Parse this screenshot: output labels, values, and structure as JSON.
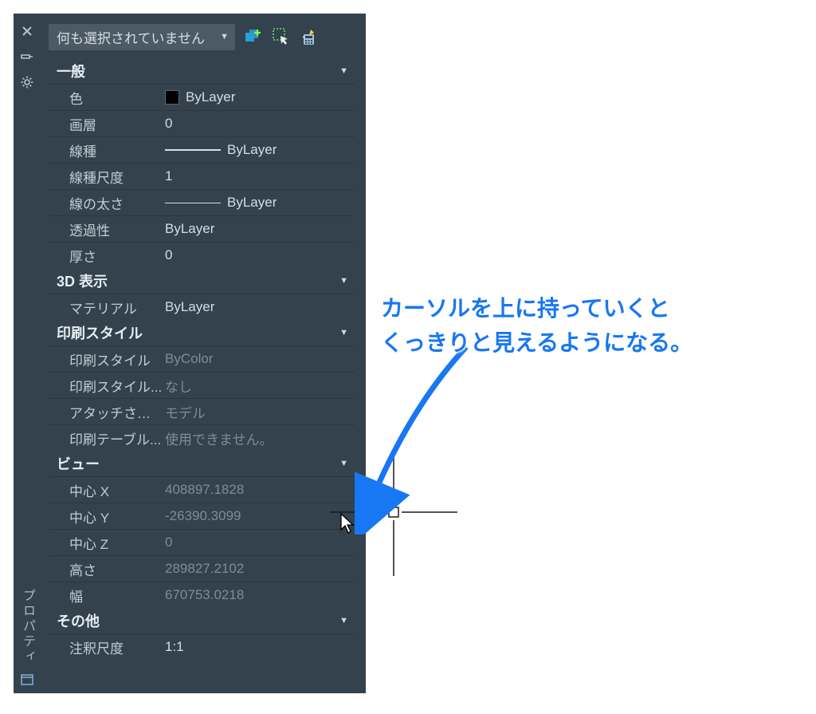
{
  "palette_title": "プロパティ",
  "header": {
    "selection_label": "何も選択されていません"
  },
  "categories": [
    {
      "name": "一般",
      "rows": [
        {
          "label": "色",
          "value": "ByLayer",
          "swatch": true
        },
        {
          "label": "画層",
          "value": "0"
        },
        {
          "label": "線種",
          "value": "ByLayer",
          "linetype": true
        },
        {
          "label": "線種尺度",
          "value": "1"
        },
        {
          "label": "線の太さ",
          "value": "ByLayer",
          "lineweight": true
        },
        {
          "label": "透過性",
          "value": "ByLayer"
        },
        {
          "label": "厚さ",
          "value": "0"
        }
      ]
    },
    {
      "name": "3D 表示",
      "rows": [
        {
          "label": "マテリアル",
          "value": "ByLayer"
        }
      ]
    },
    {
      "name": "印刷スタイル",
      "rows": [
        {
          "label": "印刷スタイル",
          "value": "ByColor",
          "readonly": true
        },
        {
          "label": "印刷スタイル...",
          "value": "なし",
          "readonly": true
        },
        {
          "label": "アタッチされた...",
          "value": "モデル",
          "readonly": true
        },
        {
          "label": "印刷テーブル...",
          "value": "使用できません。",
          "readonly": true
        }
      ]
    },
    {
      "name": "ビュー",
      "rows": [
        {
          "label": "中心 X",
          "value": "408897.1828",
          "readonly": true
        },
        {
          "label": "中心 Y",
          "value": "-26390.3099",
          "readonly": true
        },
        {
          "label": "中心 Z",
          "value": "0",
          "readonly": true
        },
        {
          "label": "高さ",
          "value": "289827.2102",
          "readonly": true
        },
        {
          "label": "幅",
          "value": "670753.0218",
          "readonly": true
        }
      ]
    },
    {
      "name": "その他",
      "rows": [
        {
          "label": "注釈尺度",
          "value": "1:1"
        }
      ]
    }
  ],
  "annotation": {
    "line1": "カーソルを上に持っていくと",
    "line2": "くっきりと見えるようになる。"
  }
}
